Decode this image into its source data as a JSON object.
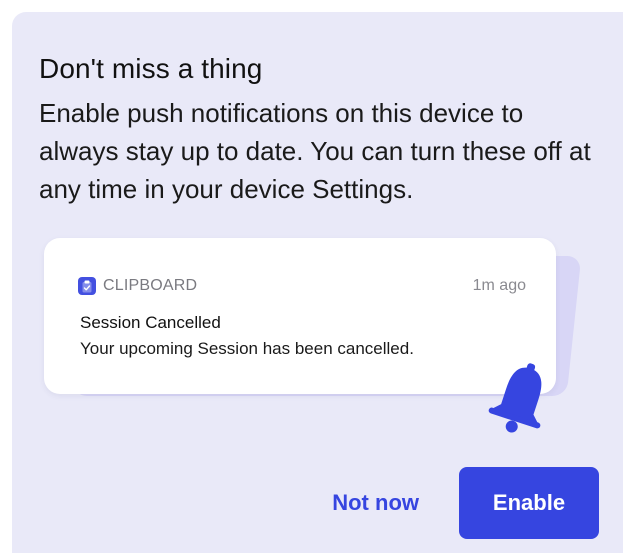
{
  "prompt": {
    "title": "Don't miss a thing",
    "body": "Enable push notifications on this device to always stay up to date. You can turn these off at any time in your device Settings."
  },
  "notification": {
    "app_icon": "clipboard-icon",
    "app_name": "CLIPBOARD",
    "time": "1m ago",
    "title": "Session Cancelled",
    "message": "Your upcoming Session has been cancelled."
  },
  "illustration": {
    "icon": "bell-icon"
  },
  "actions": {
    "secondary_label": "Not now",
    "primary_label": "Enable"
  },
  "colors": {
    "accent": "#3645e0",
    "card_background": "#e9e9f8",
    "illustration_shadow": "#d8d6f6"
  }
}
